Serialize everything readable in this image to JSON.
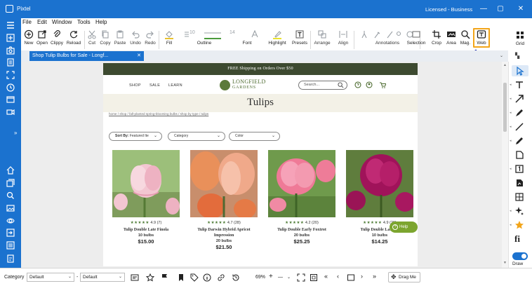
{
  "app": {
    "title": "Pixtel",
    "license": "Licensed - Business",
    "win_controls": [
      "—",
      "▢",
      "▣",
      "✕"
    ]
  },
  "menu": [
    "File",
    "Edit",
    "Window",
    "Tools",
    "Help"
  ],
  "toolbar": {
    "new": "New",
    "open": "Open",
    "clippy": "Clippy",
    "reload": "Reload",
    "cut": "Cut",
    "copy": "Copy",
    "paste": "Paste",
    "undo": "Undo",
    "redo": "Redo",
    "fill": "Fill",
    "outline": "Outline",
    "outline_width": "10",
    "font": "Font",
    "font_size": "14",
    "highlight": "Highlight",
    "presets": "Presets",
    "arrange": "Arrange",
    "align": "Align",
    "annotations": "Annotations",
    "selection": "Selection",
    "crop": "Crop",
    "area": "Area",
    "mag": "Mag.",
    "web": "Web",
    "grid": "Grid"
  },
  "tab": {
    "label": "Shop Tulip Bulbs for Sale - Longf...",
    "close": "✕"
  },
  "webpage": {
    "shipping": "FREE Shipping on Orders Over $50",
    "nav": [
      "SHOP",
      "SALE",
      "LEARN"
    ],
    "logo_line1": "LONGFIELD",
    "logo_line2": "GARDENS",
    "search_placeholder": "Search...",
    "heading": "Tulips",
    "breadcrumb": "home / shop / fall-planted spring-blooming bulbs / shop by type / tulips",
    "filters": {
      "sort_by_label": "Sort By:",
      "sort_by_value": "Featured Ite",
      "category": "Category",
      "color": "Color"
    },
    "products": [
      {
        "name": "Tulip Double Late Finola",
        "rating": "4.9",
        "reviews": "(7)",
        "qty": "10 bulbs",
        "price": "$15.00",
        "stars": "★★★★★"
      },
      {
        "name": "Tulip Darwin Hybrid Apricot Impression",
        "rating": "4.7",
        "reviews": "(28)",
        "qty": "20 bulbs",
        "price": "$21.50",
        "stars": "★★★★★"
      },
      {
        "name": "Tulip Double Early Foxtrot",
        "rating": "4.2",
        "reviews": "(20)",
        "qty": "20 bulbs",
        "price": "$25.25",
        "stars": "★★★★★"
      },
      {
        "name": "Tulip Double Late Ne",
        "rating": "4.9",
        "reviews": "(26)",
        "qty": "10 bulbs",
        "price": "$14.25",
        "stars": "★★★★★"
      }
    ],
    "help": "Help"
  },
  "right_panel": {
    "draw": "Draw"
  },
  "statusbar": {
    "category_label": "Category",
    "category_value": "Default",
    "dash": "-",
    "second_value": "Default",
    "zoom": "69%",
    "plus": "+",
    "minus": "—",
    "drag_me": "Drag Me"
  },
  "colors": {
    "accent": "#1b72cf",
    "web_highlight": "#f2a51a",
    "shipping_bar": "#3d4a30",
    "help_button": "#7ca52f",
    "pointer_arrow": "#1c2ba8"
  }
}
